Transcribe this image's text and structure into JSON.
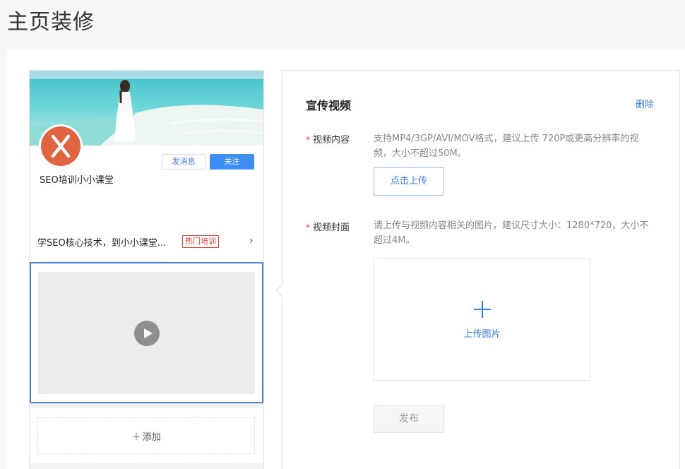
{
  "page": {
    "title": "主页装修"
  },
  "preview": {
    "account_name": "SEO培训小小课堂",
    "message_button": "发消息",
    "follow_button": "关注",
    "course": {
      "text": "学SEO核心技术，到小小课堂...",
      "tag": "热门培训",
      "chevron": "›"
    },
    "add_label": "添加",
    "add_icon": "plus-icon"
  },
  "editor": {
    "title": "宣传视频",
    "delete_label": "删除",
    "required_mark": "*",
    "video_content_label": "视频内容",
    "video_hint": "支持MP4/3GP/AVI/MOV格式，建议上传 720P或更高分辨率的视频，大小不超过50M。",
    "upload_button": "点击上传",
    "cover_label": "视频封面",
    "cover_hint": "请上传与视频内容相关的图片，建议尺寸大小：1280*720，大小不超过4M。",
    "upload_image_label": "上传图片",
    "publish_button": "发布"
  },
  "colors": {
    "accent": "#3c8ef5",
    "link": "#3c7ee0",
    "required": "#e0443b",
    "selected_border": "#4a82d9",
    "avatar": "#e0643f"
  }
}
